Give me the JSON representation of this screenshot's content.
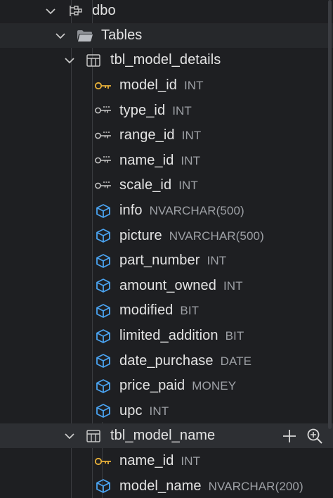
{
  "schema": {
    "label": "dbo"
  },
  "folder": {
    "label": "Tables"
  },
  "tables": [
    {
      "name": "tbl_model_details",
      "columns": [
        {
          "name": "model_id",
          "type": "INT",
          "icon": "primary-key-icon"
        },
        {
          "name": "type_id",
          "type": "INT",
          "icon": "foreign-key-icon"
        },
        {
          "name": "range_id",
          "type": "INT",
          "icon": "foreign-key-icon"
        },
        {
          "name": "name_id",
          "type": "INT",
          "icon": "foreign-key-icon"
        },
        {
          "name": "scale_id",
          "type": "INT",
          "icon": "foreign-key-icon"
        },
        {
          "name": "info",
          "type": "NVARCHAR(500)",
          "icon": "column-icon"
        },
        {
          "name": "picture",
          "type": "NVARCHAR(500)",
          "icon": "column-icon"
        },
        {
          "name": "part_number",
          "type": "INT",
          "icon": "column-icon"
        },
        {
          "name": "amount_owned",
          "type": "INT",
          "icon": "column-icon"
        },
        {
          "name": "modified",
          "type": "BIT",
          "icon": "column-icon"
        },
        {
          "name": "limited_addition",
          "type": "BIT",
          "icon": "column-icon"
        },
        {
          "name": "date_purchase",
          "type": "DATE",
          "icon": "column-icon"
        },
        {
          "name": "price_paid",
          "type": "MONEY",
          "icon": "column-icon"
        },
        {
          "name": "upc",
          "type": "INT",
          "icon": "column-icon"
        }
      ]
    },
    {
      "name": "tbl_model_name",
      "columns": [
        {
          "name": "name_id",
          "type": "INT",
          "icon": "primary-key-icon"
        },
        {
          "name": "model_name",
          "type": "NVARCHAR(200)",
          "icon": "column-icon"
        }
      ]
    }
  ],
  "colors": {
    "background": "#1e1f22",
    "primary_key": "#e8b13a",
    "column_icon": "#4aa3f0",
    "type_text": "#9ea1a6"
  }
}
